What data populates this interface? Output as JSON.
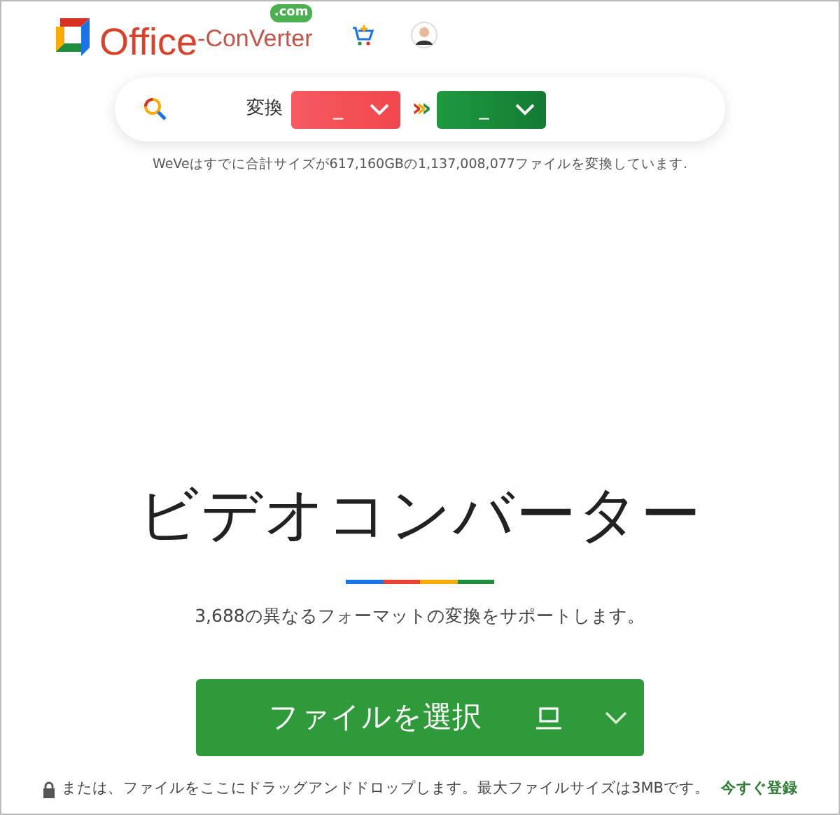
{
  "header": {
    "logo_word": "Office",
    "logo_sub": "-ConVerter",
    "logo_tld": ".com"
  },
  "converter_bar": {
    "label": "変換",
    "from_value": "_",
    "to_value": "_",
    "arrows": "›››"
  },
  "stats": "WeVeはすでに合計サイズが617,160GBの1,137,008,077ファイルを変換しています.",
  "title": "ビデオコンバーター",
  "subtitle": "3,688の異なるフォーマットの変換をサポートします。",
  "upload_button": {
    "label": "ファイルを選択"
  },
  "footer": {
    "text": "または、ファイルをここにドラッグアンドドロップします。最大ファイルサイズは3MBです。",
    "link": "今すぐ登録"
  }
}
